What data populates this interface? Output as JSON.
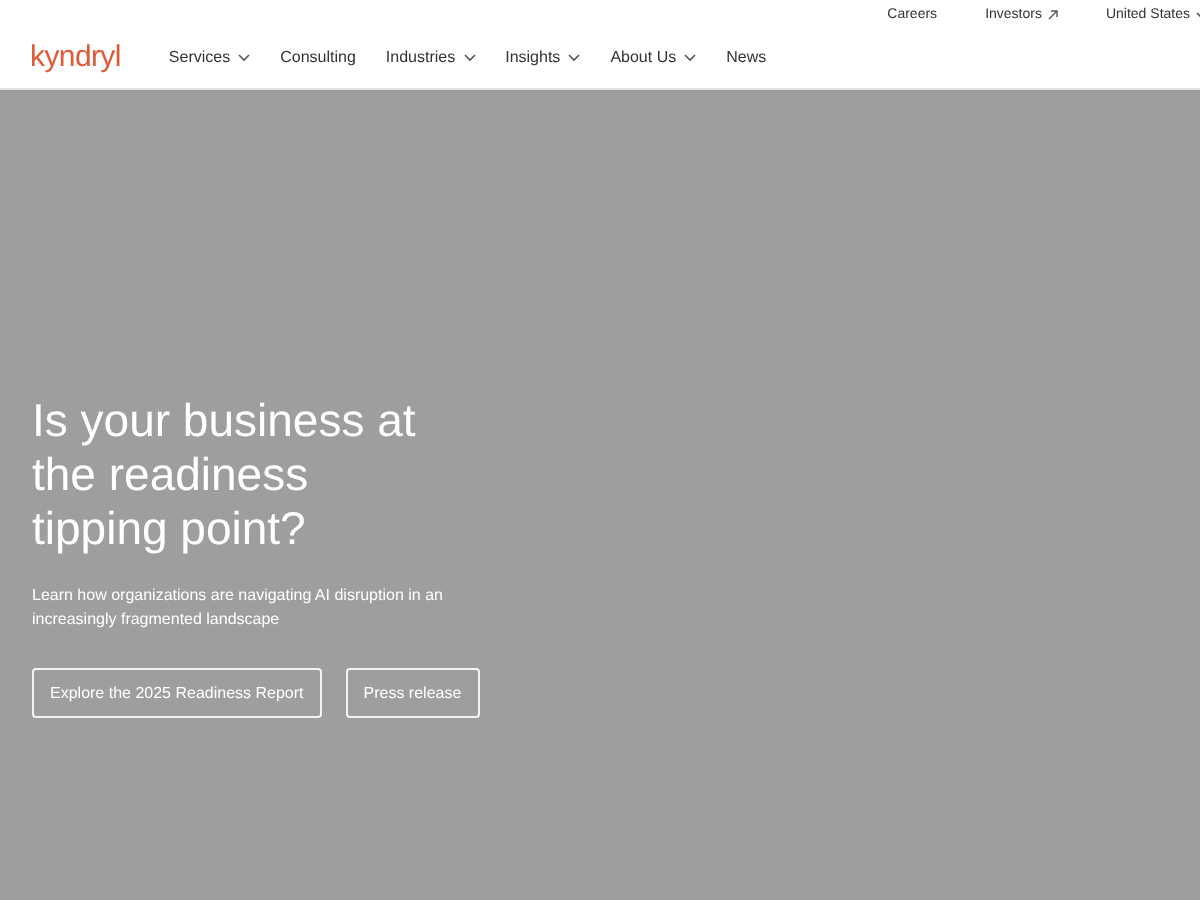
{
  "utility_links": [
    {
      "label": "Careers",
      "external": false,
      "menu": false
    },
    {
      "label": "Investors",
      "external": true,
      "menu": false
    },
    {
      "label": "United States",
      "external": false,
      "menu": true
    }
  ],
  "logo": "kyndryl",
  "nav": [
    {
      "label": "Services",
      "menu": true
    },
    {
      "label": "Consulting",
      "menu": false
    },
    {
      "label": "Industries",
      "menu": true
    },
    {
      "label": "Insights",
      "menu": true
    },
    {
      "label": "About Us",
      "menu": true
    },
    {
      "label": "News",
      "menu": false
    }
  ],
  "hero": {
    "title": "Is your business at the readiness tipping point?",
    "text": "Learn how organizations are navigating AI disruption in an increasingly fragmented landscape",
    "buttons": [
      "Explore the 2025 Readiness Report",
      "Press release"
    ]
  }
}
